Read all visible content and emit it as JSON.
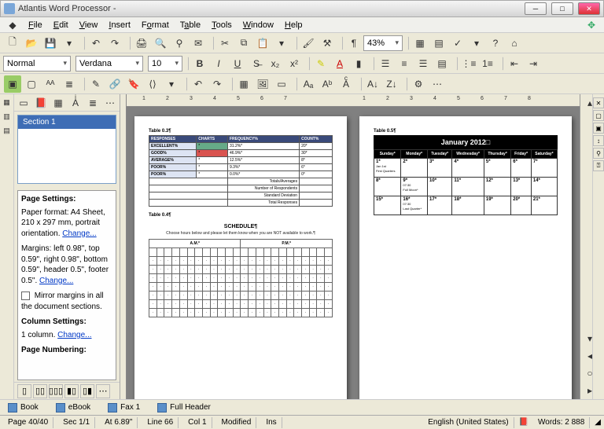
{
  "title": "Atlantis Word Processor -",
  "menu": [
    "File",
    "Edit",
    "View",
    "Insert",
    "Format",
    "Table",
    "Tools",
    "Window",
    "Help"
  ],
  "toolbar1": {
    "zoom": "43%"
  },
  "format": {
    "style": "Normal",
    "font": "Verdana",
    "size": "10"
  },
  "sidebar": {
    "section_label": "Section 1",
    "page_settings_hdr": "Page Settings:",
    "paper_format": "Paper format: A4 Sheet, 210 x 297 mm, portrait orientation.",
    "change": "Change...",
    "margins": "Margins: left 0.98\", top 0.59\", right 0.98\", bottom 0.59\", header 0.5\", footer 0.5\".",
    "mirror": "Mirror margins in all the document sections.",
    "column_hdr": "Column Settings:",
    "columns": "1 column.",
    "page_num_hdr": "Page Numbering:"
  },
  "tabs": [
    "Book",
    "eBook",
    "Fax 1",
    "Full Header"
  ],
  "status": {
    "page": "Page 40/40",
    "sec": "Sec 1/1",
    "at": "At 6.89\"",
    "line": "Line 66",
    "col": "Col 1",
    "mod": "Modified",
    "ins": "Ins",
    "lang": "English (United States)",
    "words": "Words: 2 888"
  },
  "page1": {
    "tcap1": "Table 0.3¶",
    "headers": [
      "RESPONSES",
      "CHARTS",
      "FREQUENCY%",
      "COUNT%"
    ],
    "rows": [
      [
        "EXCELLENT%",
        "",
        "31.2%*",
        "20*"
      ],
      [
        "GOOD%",
        "",
        "46.9%*",
        "30*"
      ],
      [
        "AVERAGE%",
        "",
        "12.5%*",
        "8*"
      ],
      [
        "POOR%",
        "",
        "9.3%*",
        "6*"
      ],
      [
        "POOR%",
        "",
        "0.0%*",
        "0*"
      ]
    ],
    "foot": [
      [
        "Totals/Averages",
        "",
        ""
      ],
      [
        "Number of Respondents",
        "",
        ""
      ],
      [
        "Standard Deviation",
        "",
        ""
      ],
      [
        "Total Responses",
        "",
        ""
      ]
    ],
    "tcap2": "Table 0.4¶",
    "sched_title": "SCHEDULE¶",
    "sched_note": "Choose hours below and please let them know when you are NOT available to work.¶",
    "am": "A.M.*",
    "pm": "P.M.*"
  },
  "page2": {
    "tcap": "Table 0.5¶",
    "cal_title": "January 2012□",
    "days": [
      "Sunday*",
      "Monday*",
      "Tuesday*",
      "Wednesday*",
      "Thursday*",
      "Friday*",
      "Saturday*"
    ],
    "weeks": [
      [
        {
          "n": "1*",
          "t": "Jan 1st\nFirst Quarters"
        },
        {
          "n": "2*"
        },
        {
          "n": "3*"
        },
        {
          "n": "4*"
        },
        {
          "n": "5*"
        },
        {
          "n": "6*"
        },
        {
          "n": "7*"
        }
      ],
      [
        {
          "n": "8*"
        },
        {
          "n": "9*",
          "t": "07:30\nFull Moon*"
        },
        {
          "n": "10*"
        },
        {
          "n": "11*"
        },
        {
          "n": "12*"
        },
        {
          "n": "13*"
        },
        {
          "n": "14*"
        }
      ],
      [
        {
          "n": "15*"
        },
        {
          "n": "16*",
          "t": "07:30\nLast Quarter*"
        },
        {
          "n": "17*"
        },
        {
          "n": "18*"
        },
        {
          "n": "19*"
        },
        {
          "n": "20*"
        },
        {
          "n": "21*"
        }
      ]
    ]
  }
}
